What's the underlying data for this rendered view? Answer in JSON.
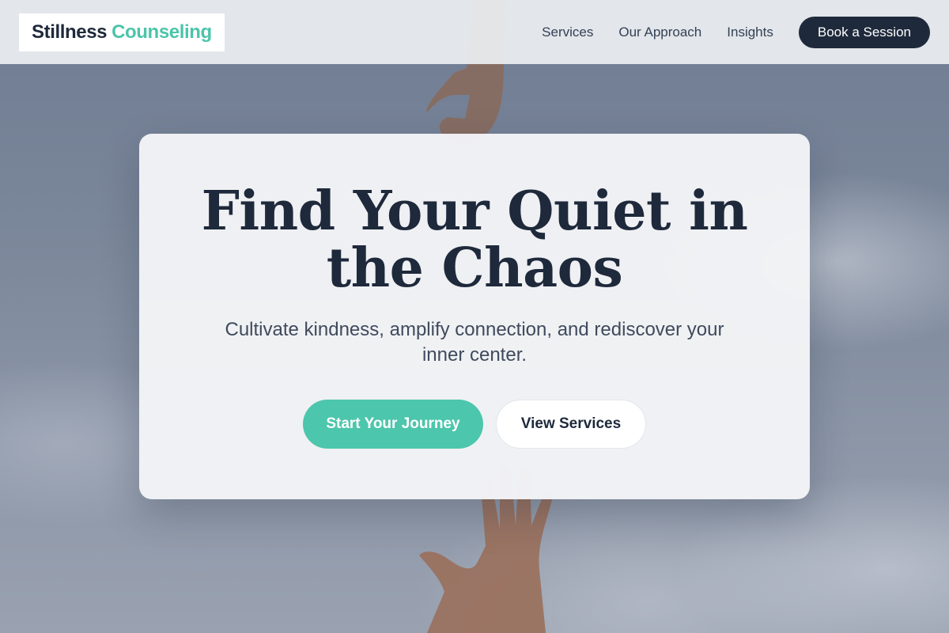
{
  "header": {
    "logo": {
      "word_1": "Stillness",
      "word_2": "Counseling"
    },
    "nav": [
      {
        "label": "Services"
      },
      {
        "label": "Our Approach"
      },
      {
        "label": "Insights"
      }
    ],
    "cta_label": "Book a Session"
  },
  "hero": {
    "title": "Find Your Quiet in the Chaos",
    "subtitle": "Cultivate kindness, amplify connection, and rediscover your inner center.",
    "primary_button": "Start Your Journey",
    "secondary_button": "View Services"
  },
  "colors": {
    "navy": "#1e293b",
    "accent": "#4cc4aa",
    "sky": "#7a8699"
  }
}
